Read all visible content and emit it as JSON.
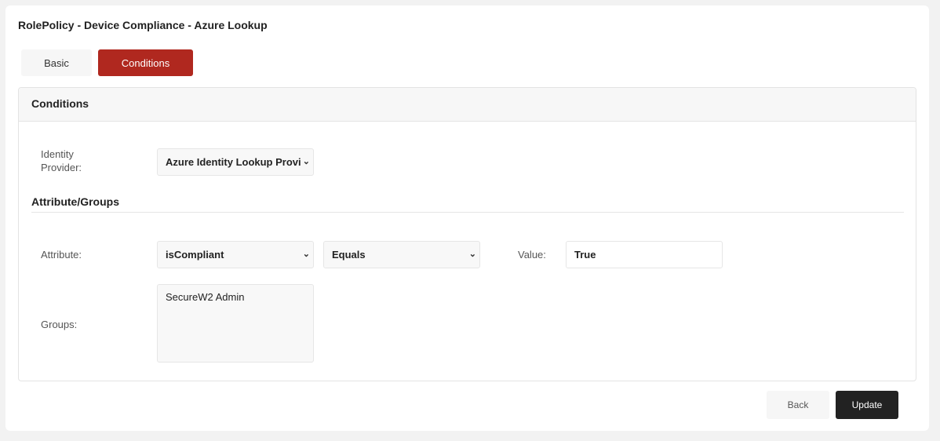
{
  "title": "RolePolicy - Device Compliance - Azure Lookup",
  "tabs": [
    {
      "label": "Basic",
      "active": false
    },
    {
      "label": "Conditions",
      "active": true
    }
  ],
  "panel": {
    "title": "Conditions",
    "identity_provider": {
      "label": "Identity Provider:",
      "value": "Azure Identity Lookup Provi"
    },
    "section_title": "Attribute/Groups",
    "attribute": {
      "label": "Attribute:",
      "value": "isCompliant",
      "operator": "Equals",
      "value_label": "Value:",
      "value_input": "True"
    },
    "groups": {
      "label": "Groups:",
      "items": [
        "SecureW2 Admin"
      ]
    }
  },
  "footer": {
    "back": "Back",
    "update": "Update"
  },
  "colors": {
    "accent": "#b0281f",
    "primary_button": "#222222"
  }
}
